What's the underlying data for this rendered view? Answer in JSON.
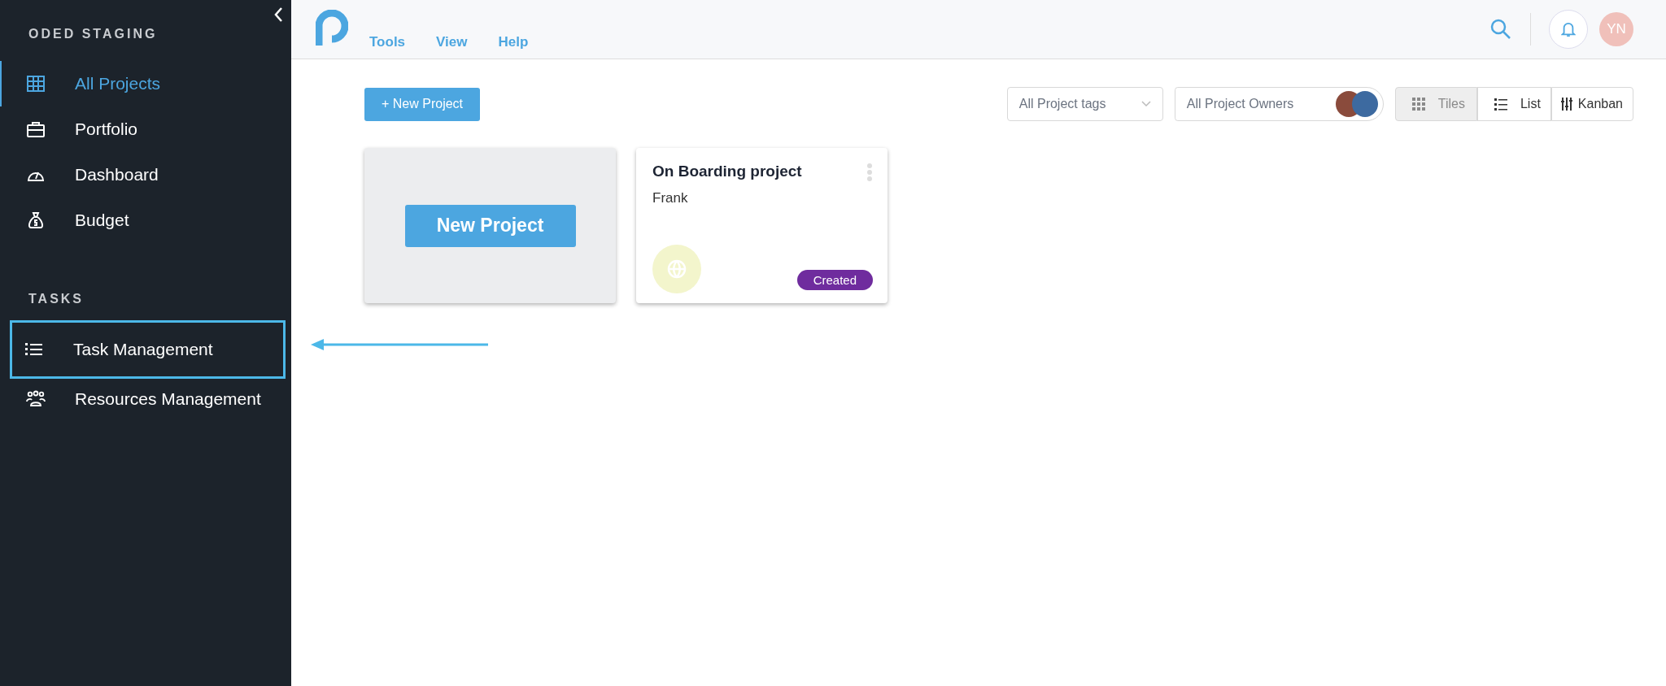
{
  "sidebar": {
    "sections": [
      {
        "title": "ODED STAGING",
        "items": [
          {
            "label": "All Projects",
            "selected": true,
            "highlighted": false
          },
          {
            "label": "Portfolio",
            "selected": false,
            "highlighted": false
          },
          {
            "label": "Dashboard",
            "selected": false,
            "highlighted": false
          },
          {
            "label": "Budget",
            "selected": false,
            "highlighted": false
          }
        ]
      },
      {
        "title": "TASKS",
        "items": [
          {
            "label": "Task Management",
            "selected": false,
            "highlighted": true
          },
          {
            "label": "Resources Management",
            "selected": false,
            "highlighted": false
          }
        ]
      }
    ]
  },
  "top_bar": {
    "menu": [
      "Tools",
      "View",
      "Help"
    ],
    "avatar": "YN"
  },
  "toolbar": {
    "new_button": "+ New Project",
    "tags_filter": "All Project tags",
    "owners_filter": "All Project Owners",
    "views": [
      {
        "label": "Tiles",
        "selected": true
      },
      {
        "label": "List",
        "selected": false
      },
      {
        "label": "Kanban",
        "selected": false
      }
    ]
  },
  "new_tile": {
    "button": "New Project"
  },
  "projects": [
    {
      "title": "On Boarding project",
      "owner": "Frank",
      "status": "Created",
      "color": "#6f2c9e"
    }
  ]
}
